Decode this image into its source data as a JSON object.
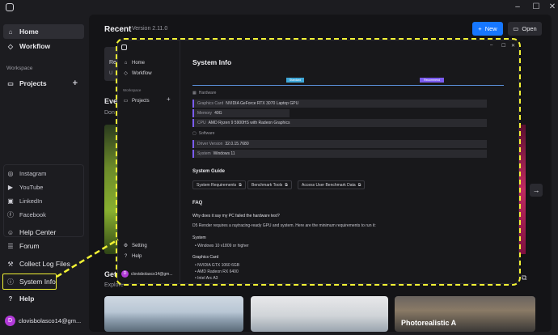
{
  "window": {
    "minimize": "–",
    "maximize": "☐",
    "close": "✕"
  },
  "sidebar": {
    "home": "Home",
    "workflow": "Workflow",
    "workspace_label": "Workspace",
    "projects": "Projects",
    "add": "+",
    "social": [
      "Instagram",
      "YouTube",
      "LinkedIn",
      "Facebook"
    ],
    "help_center": "Help Center",
    "forum": "Forum",
    "collect_logs": "Collect Log Files",
    "system_info": "System Info",
    "help": "Help",
    "user_email": "clovisbolasco14@gm...",
    "avatar_letter": "D"
  },
  "header": {
    "title": "Recent",
    "version": "Version 2.11.0",
    "new_label": "New",
    "open_label": "Open"
  },
  "background_fragments": {
    "events": "Eve",
    "dont": "Don",
    "rec_r": "Re",
    "rec_u": "U",
    "get_started": "Get",
    "explore": "Explore"
  },
  "thumb_caption": "Photorealistic A",
  "modal": {
    "sidebar": {
      "home": "Home",
      "workflow": "Workflow",
      "workspace_label": "Workspace",
      "projects": "Projects",
      "add": "+",
      "setting": "Setting",
      "help": "Help",
      "user_email": "clovisbolasco14@gm...",
      "avatar_letter": "D"
    },
    "title": "System Info",
    "legend": {
      "standard": "Standard",
      "recommend": "Recommend"
    },
    "hardware_label": "Hardware",
    "hardware": [
      {
        "key": "Graphics Card",
        "value": "NVIDIA GeForce RTX 3070 Laptop GPU"
      },
      {
        "key": "Memory",
        "value": "40G"
      },
      {
        "key": "CPU",
        "value": "AMD Ryzen 9 5900HS with Radeon Graphics"
      }
    ],
    "software_label": "Software",
    "software": [
      {
        "key": "Driver Version",
        "value": "32.0.15.7680"
      },
      {
        "key": "System",
        "value": "Windows 11"
      }
    ],
    "guide_title": "System Guide",
    "guide_buttons": [
      "System Requirements",
      "Benchmark Tools",
      "Access User Benchmark Data"
    ],
    "faq_title": "FAQ",
    "faq_question": "Why does it say my PC failed the hardware test?",
    "faq_answer": "D5 Render requires a raytracing-ready GPU and system. Here are the minimum requirements to run it:",
    "system_head": "System",
    "system_items": [
      "Windows 10 v1809 or higher"
    ],
    "gpu_head": "Graphics Card",
    "gpu_items": [
      "NVIDIA GTX 1060 6GB",
      "AMD Radeon RX 6400",
      "Intel Arc A3"
    ]
  },
  "colors": {
    "accent_blue": "#1677ff",
    "highlight": "#f2f234",
    "purple": "#7b5cf0",
    "avatar": "#b23ad8"
  }
}
